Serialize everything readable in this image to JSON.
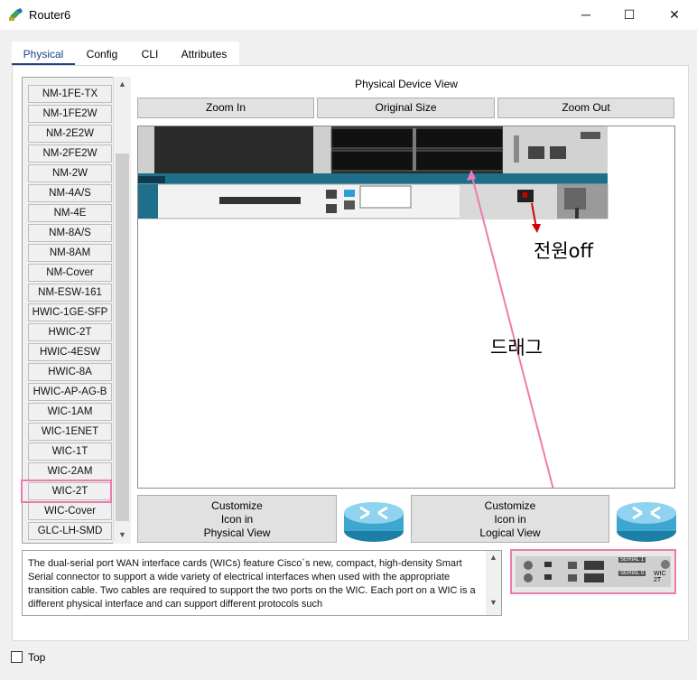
{
  "window": {
    "title": "Router6",
    "minimize": "─",
    "maximize": "☐",
    "close": "✕"
  },
  "tabs": [
    {
      "label": "Physical",
      "active": true
    },
    {
      "label": "Config",
      "active": false
    },
    {
      "label": "CLI",
      "active": false
    },
    {
      "label": "Attributes",
      "active": false
    }
  ],
  "modules": {
    "items": [
      "NM-1FE-TX",
      "NM-1FE2W",
      "NM-2E2W",
      "NM-2FE2W",
      "NM-2W",
      "NM-4A/S",
      "NM-4E",
      "NM-8A/S",
      "NM-8AM",
      "NM-Cover",
      "NM-ESW-161",
      "HWIC-1GE-SFP",
      "HWIC-2T",
      "HWIC-4ESW",
      "HWIC-8A",
      "HWIC-AP-AG-B",
      "WIC-1AM",
      "WIC-1ENET",
      "WIC-1T",
      "WIC-2AM",
      "WIC-2T",
      "WIC-Cover",
      "GLC-LH-SMD"
    ],
    "selected": "WIC-2T"
  },
  "device_view": {
    "title": "Physical Device View",
    "zoom_in": "Zoom In",
    "original_size": "Original Size",
    "zoom_out": "Zoom Out"
  },
  "customize": {
    "physical_label": "Customize\nIcon in\nPhysical View",
    "logical_label": "Customize\nIcon in\nLogical View"
  },
  "description": "The dual-serial port WAN interface cards (WICs) feature Cisco`s new, compact, high-density Smart Serial connector to support a wide variety of electrical interfaces when used with the appropriate transition cable. Two cables are required to support the two ports on the WIC. Each port on a WIC is a different physical interface and can support different protocols such",
  "wic_preview": {
    "serial0": "SERIAL 1",
    "serial1": "SERIAL 0",
    "model": "WIC 2T"
  },
  "footer": {
    "top_label": "Top"
  },
  "annotations": {
    "power_off": "전원off",
    "drag": "드래그",
    "highlight_color": "#f07ab0",
    "arrow_color": "#d40000"
  }
}
